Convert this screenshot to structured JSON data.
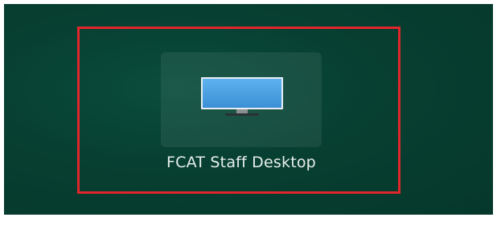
{
  "desktop": {
    "app_name": "FCAT Staff Desktop",
    "icon": "monitor-icon"
  },
  "colors": {
    "background": "#073f31",
    "highlight": "#e0262b",
    "screen_fill": "#4a9fe0"
  }
}
